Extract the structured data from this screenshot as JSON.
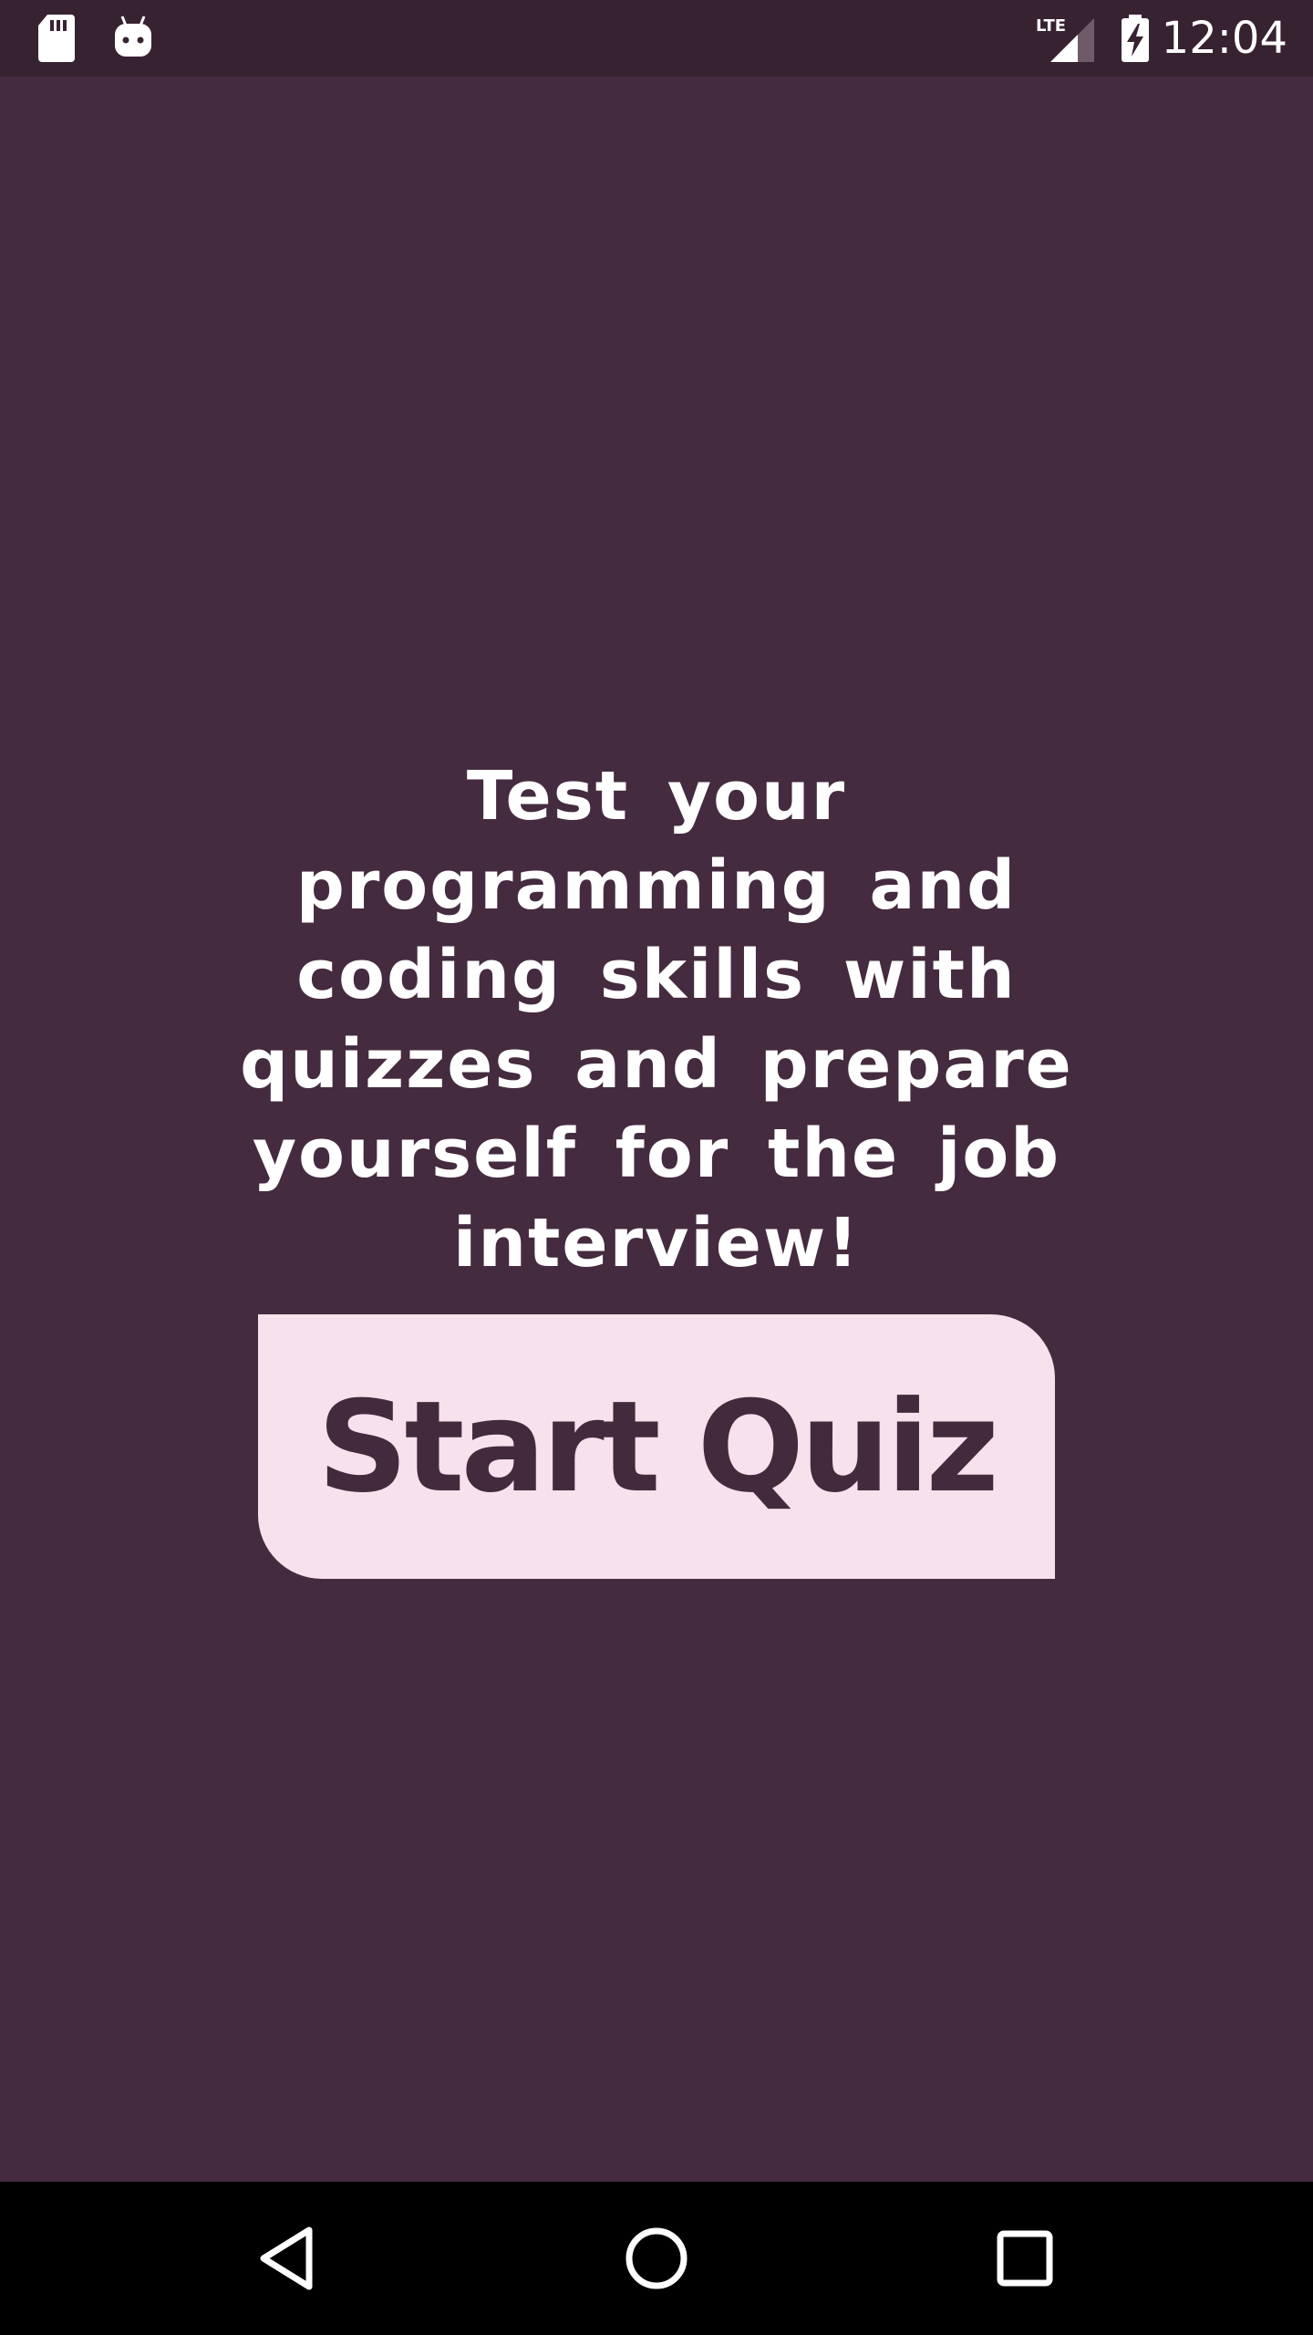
{
  "status_bar": {
    "time": "12:04",
    "network": "LTE",
    "icons": [
      "sd-card-icon",
      "android-debug-icon",
      "lte-signal-icon",
      "battery-charging-icon"
    ]
  },
  "main": {
    "headline": "Test your programming and coding skills with quizzes and prepare yourself for the job interview!",
    "start_button_label": "Start Quiz"
  },
  "nav_bar": {
    "icons": [
      "back-icon",
      "home-icon",
      "recents-icon"
    ]
  },
  "colors": {
    "background": "#452b3f",
    "status_bar": "#372232",
    "button_bg": "#f6e1ec",
    "button_text": "#432a3d",
    "nav_bar": "#000000"
  }
}
